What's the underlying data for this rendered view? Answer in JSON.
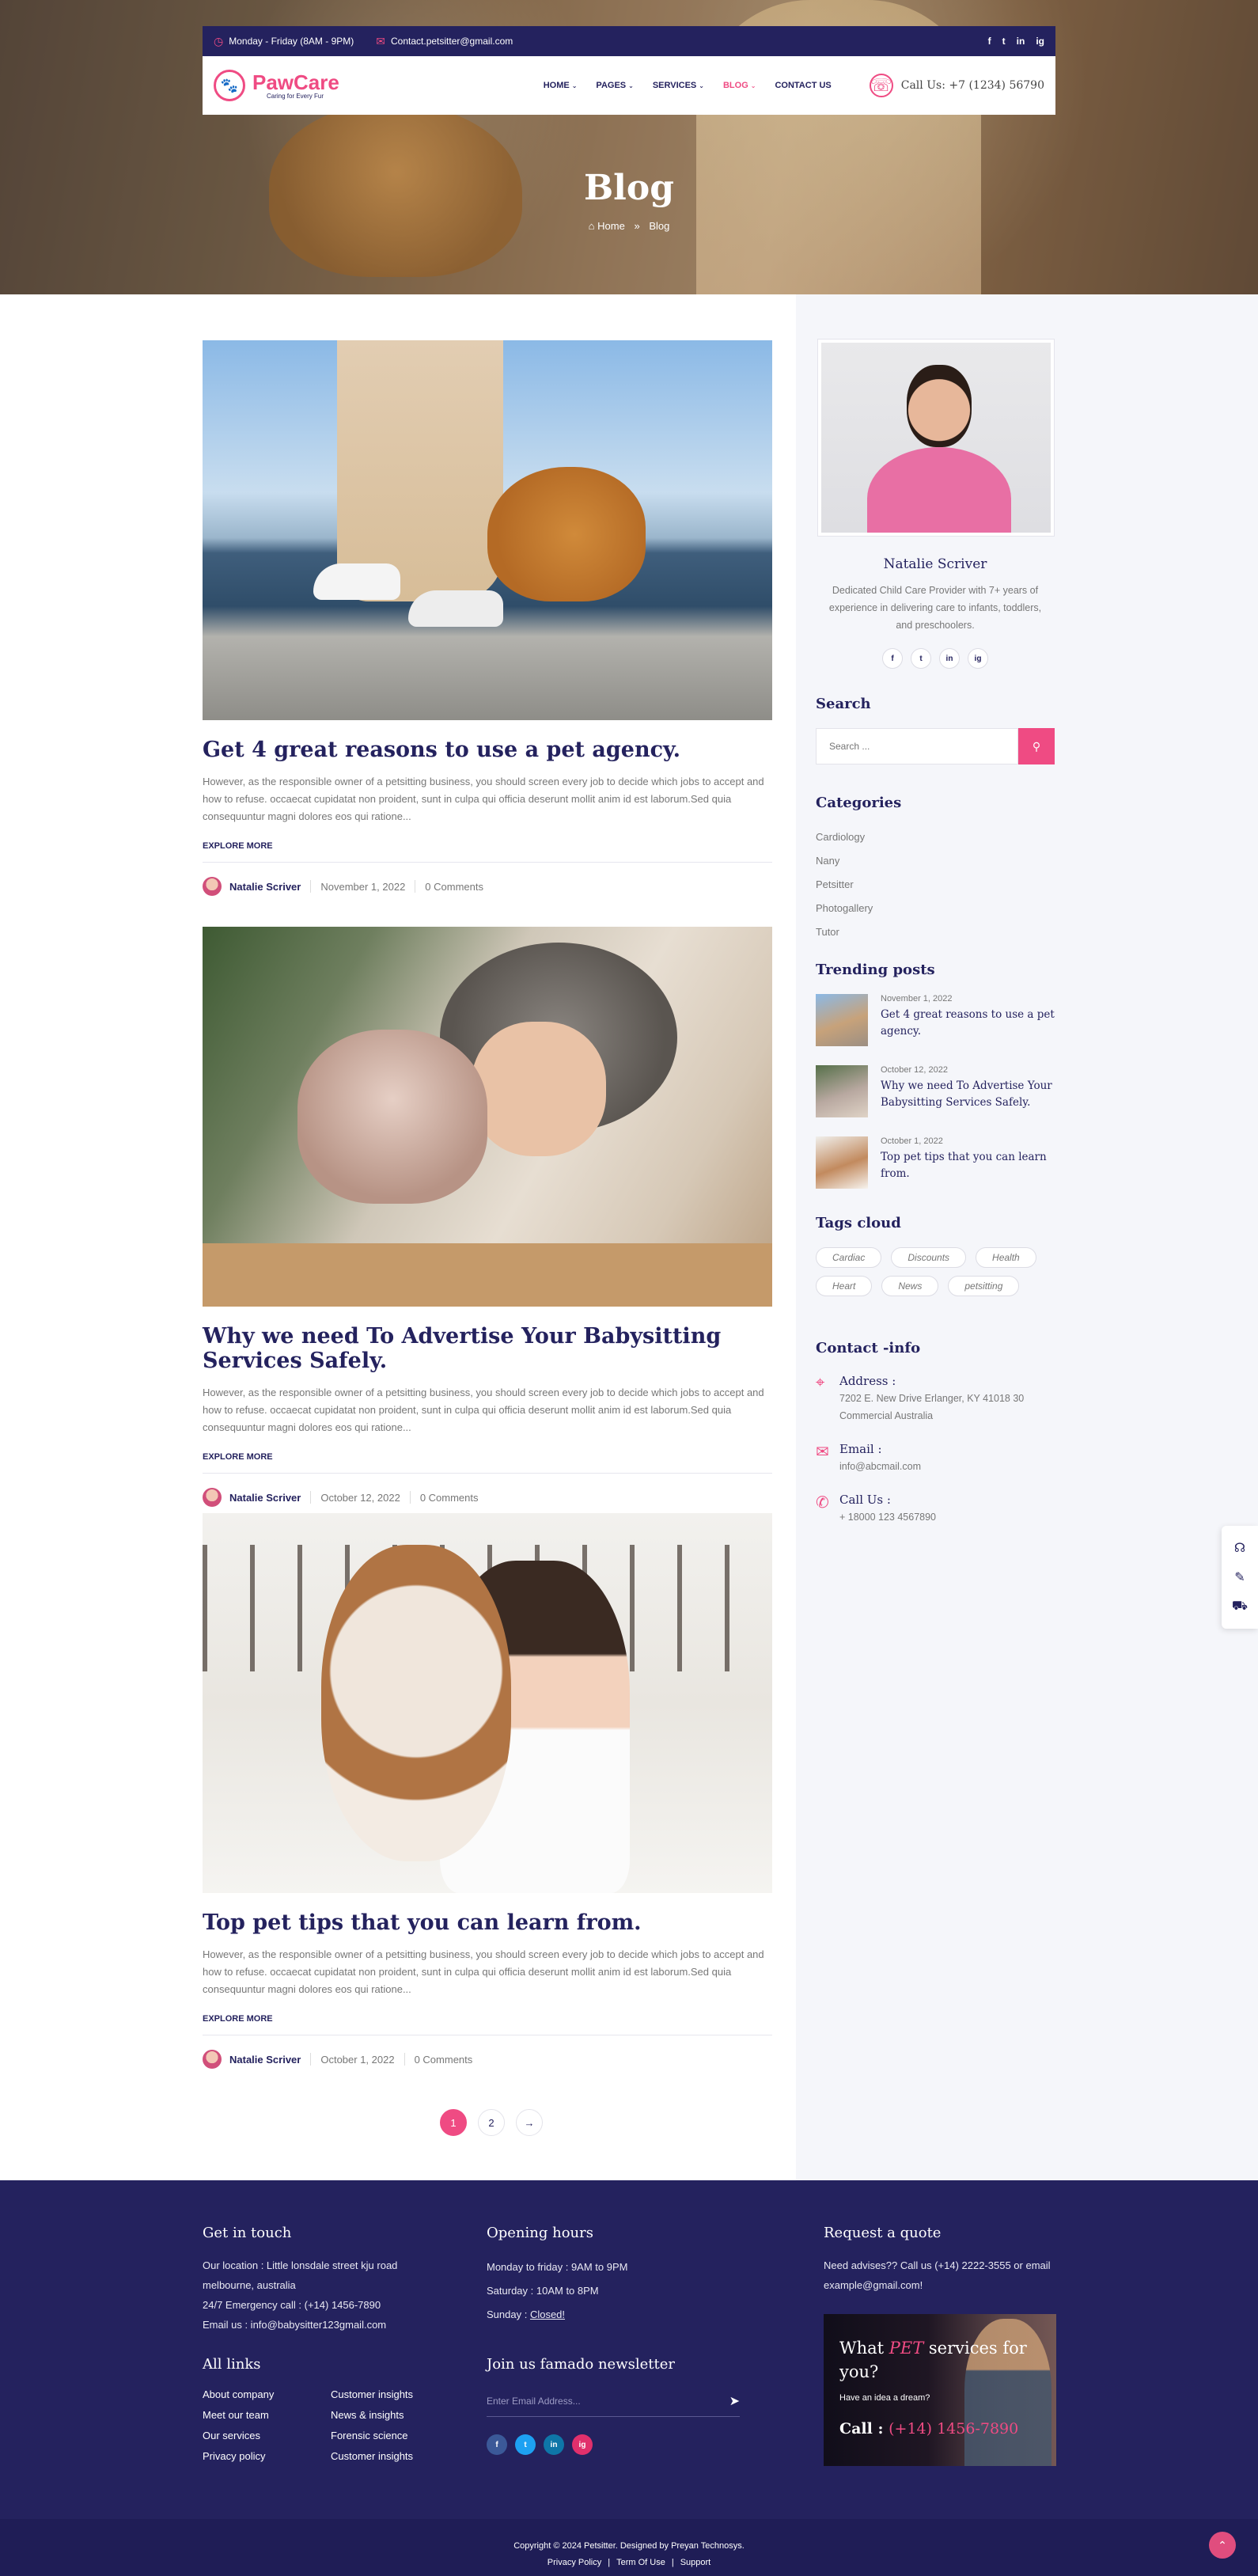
{
  "topbar": {
    "hours": "Monday - Friday (8AM - 9PM)",
    "email": "Contact.petsitter@gmail.com",
    "social": [
      "f",
      "t",
      "in",
      "ig"
    ]
  },
  "brand": {
    "name": "PawCare",
    "tagline": "Caring for Every Fur"
  },
  "nav": {
    "items": [
      "HOME",
      "PAGES",
      "SERVICES",
      "BLOG",
      "CONTACT US"
    ],
    "active": "BLOG",
    "call": "Call Us: +7 (1234) 56790"
  },
  "hero": {
    "title": "Blog",
    "crumb_home": "Home",
    "crumb_current": "Blog"
  },
  "posts": [
    {
      "title": "Get 4 great reasons to use a pet agency.",
      "excerpt": "However, as the responsible owner of a petsitting business, you should screen every job to decide which jobs to accept and how to refuse. occaecat cupidatat non proident, sunt in culpa qui officia deserunt mollit anim id est laborum.Sed quia consequuntur magni dolores eos qui ratione...",
      "cta": "EXPLORE MORE",
      "author": "Natalie Scriver",
      "date": "November 1, 2022",
      "comments": "0 Comments"
    },
    {
      "title": "Why we need To Advertise Your Babysitting Services Safely.",
      "excerpt": "However, as the responsible owner of a petsitting business, you should screen every job to decide which jobs to accept and how to refuse. occaecat cupidatat non proident, sunt in culpa qui officia deserunt mollit anim id est laborum.Sed quia consequuntur magni dolores eos qui ratione...",
      "cta": "EXPLORE MORE",
      "author": "Natalie Scriver",
      "date": "October 12, 2022",
      "comments": "0 Comments"
    },
    {
      "title": "Top pet tips that you can learn from.",
      "excerpt": "However, as the responsible owner of a petsitting business, you should screen every job to decide which jobs to accept and how to refuse. occaecat cupidatat non proident, sunt in culpa qui officia deserunt mollit anim id est laborum.Sed quia consequuntur magni dolores eos qui ratione...",
      "cta": "EXPLORE MORE",
      "author": "Natalie Scriver",
      "date": "October 1, 2022",
      "comments": "0 Comments"
    }
  ],
  "pagination": {
    "pages": [
      "1",
      "2"
    ],
    "current": "1",
    "next": "→"
  },
  "sidebar": {
    "profile": {
      "name": "Natalie Scriver",
      "bio": "Dedicated Child Care Provider with 7+ years of experience in delivering care to infants, toddlers, and preschoolers.",
      "social": [
        "f",
        "t",
        "in",
        "ig"
      ]
    },
    "search": {
      "title": "Search",
      "placeholder": "Search ..."
    },
    "categories": {
      "title": "Categories",
      "items": [
        "Cardiology",
        "Nany",
        "Petsitter",
        "Photogallery",
        "Tutor"
      ]
    },
    "trending": {
      "title": "Trending posts",
      "items": [
        {
          "date": "November 1, 2022",
          "title": "Get 4 great reasons to use a pet agency."
        },
        {
          "date": "October 12, 2022",
          "title": "Why we need To Advertise Your Babysitting Services Safely."
        },
        {
          "date": "October 1, 2022",
          "title": "Top pet tips that you can learn from."
        }
      ]
    },
    "tags": {
      "title": "Tags cloud",
      "items": [
        "Cardiac",
        "Discounts",
        "Health",
        "Heart",
        "News",
        "petsitting"
      ]
    },
    "contact": {
      "title": "Contact -info",
      "address_label": "Address :",
      "address": "7202 E. New Drive Erlanger, KY 41018 30 Commercial Australia",
      "email_label": "Email :",
      "email": "info@abcmail.com",
      "call_label": "Call Us :",
      "phone": "+ 18000 123 4567890"
    }
  },
  "footer": {
    "touch": {
      "title": "Get in touch",
      "location": "Our location : Little lonsdale street kju road melbourne, australia",
      "emergency": "24/7 Emergency call : (+14) 1456-7890",
      "email": "Email us : info@babysitter123gmail.com"
    },
    "hours": {
      "title": "Opening hours",
      "weekday": "Monday to friday : 9AM to 9PM",
      "saturday": "Saturday : 10AM to 8PM",
      "sunday_label": "Sunday : ",
      "sunday_value": "Closed!"
    },
    "quote": {
      "title": "Request a quote",
      "text": "Need advises?? Call us (+14) 2222-3555 or email example@gmail.com!",
      "card_pre": "What ",
      "card_pet": "PET",
      "card_post": " services for you?",
      "card_sub": "Have an idea a dream?",
      "card_call_label": "Call : ",
      "card_call_value": "(+14) 1456-7890"
    },
    "links": {
      "title": "All links",
      "items": [
        "About company",
        "Customer insights",
        "Meet our team",
        "News & insights",
        "Our services",
        "Forensic science",
        "Privacy policy",
        "Customer insights"
      ]
    },
    "newsletter": {
      "title": "Join us famado newsletter",
      "placeholder": "Enter Email Address..."
    },
    "social": [
      "f",
      "t",
      "in",
      "ig"
    ],
    "social_colors": [
      "#3b5998",
      "#1da1f2",
      "#0e76a8",
      "#e1306c"
    ],
    "copyright": "Copyright © 2024 Petsitter. Designed by Preyan Technosys.",
    "bottom_links": [
      "Privacy Policy",
      "Term Of Use",
      "Support"
    ]
  },
  "accent": "#ef4b83",
  "navy": "#24225e"
}
